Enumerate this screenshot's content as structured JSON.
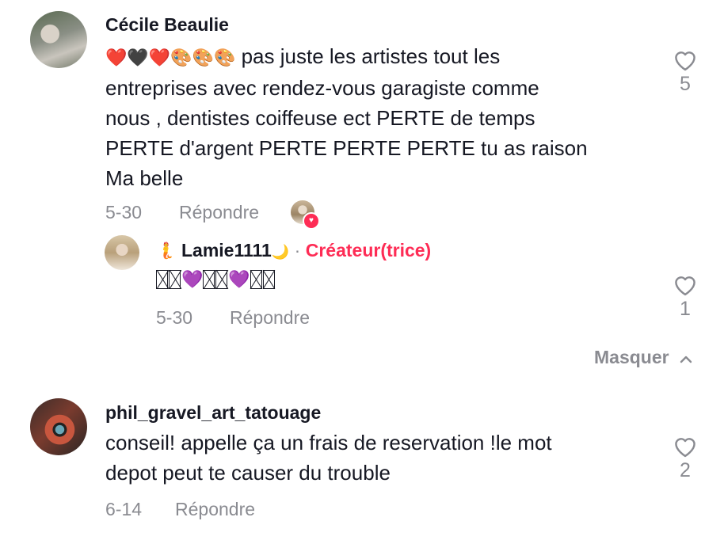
{
  "comments": [
    {
      "username": "Cécile Beaulie",
      "emoji_prefix": "❤️🖤❤️🎨🎨🎨",
      "text_lines": [
        "pas juste les artistes tout les",
        "entreprises avec rendez-vous garagiste comme",
        "nous , dentistes coiffeuse ect PERTE de temps",
        "PERTE d'argent PERTE PERTE PERTE tu as raison",
        "Ma belle"
      ],
      "date": "5-30",
      "reply_label": "Répondre",
      "likes": "5"
    },
    {
      "username": "phil_gravel_art_tatouage",
      "text_lines": [
        "conseil! appelle ça un frais de reservation !le mot",
        "depot peut te causer du trouble"
      ],
      "date": "6-14",
      "reply_label": "Répondre",
      "likes": "2"
    }
  ],
  "reply": {
    "badge_emoji": "🧜",
    "username": "Lamie1111",
    "username_suffix": "🌙",
    "separator": "·",
    "creator_label": "Créateur(trice)",
    "hearts": [
      "💜",
      "💜"
    ],
    "date": "5-30",
    "reply_label": "Répondre",
    "likes": "1"
  },
  "collapse": {
    "label": "Masquer",
    "icon": "chevron-up-icon"
  },
  "colors": {
    "accent": "#fe2c55",
    "muted": "#8a8b91",
    "text": "#161823"
  }
}
